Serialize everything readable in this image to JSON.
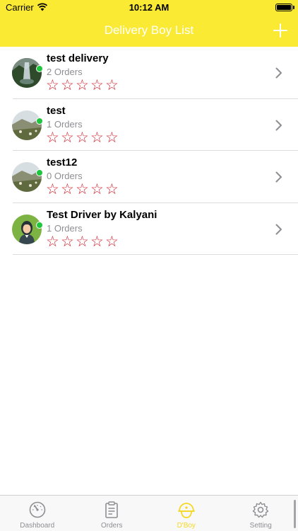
{
  "status_bar": {
    "carrier": "Carrier",
    "time": "10:12 AM"
  },
  "header": {
    "title": "Delivery Boy List",
    "add_icon": "plus-icon"
  },
  "colors": {
    "header": "#FAEA33",
    "online": "#1FC53D",
    "star": "#D21F2A",
    "active_tab": "#F5D824"
  },
  "delivery_boys": [
    {
      "name": "test delivery",
      "orders": "2 Orders",
      "rating": 0
    },
    {
      "name": "test",
      "orders": "1 Orders",
      "rating": 0
    },
    {
      "name": "test12",
      "orders": "0 Orders",
      "rating": 0
    },
    {
      "name": "Test Driver by Kalyani",
      "orders": "1 Orders",
      "rating": 0
    }
  ],
  "star_glyph": "☆",
  "tabs": [
    {
      "label": "Dashboard",
      "icon": "speedometer-icon",
      "active": false
    },
    {
      "label": "Orders",
      "icon": "clipboard-icon",
      "active": false
    },
    {
      "label": "D'Boy",
      "icon": "delivery-helmet-icon",
      "active": true
    },
    {
      "label": "Setting",
      "icon": "gear-icon",
      "active": false
    }
  ]
}
